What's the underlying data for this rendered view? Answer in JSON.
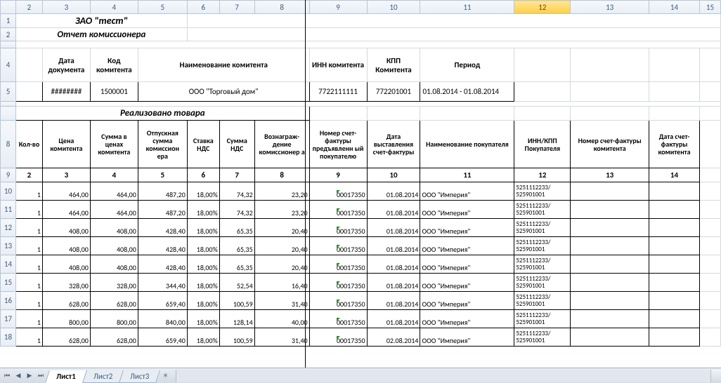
{
  "columns": [
    "",
    "2",
    "3",
    "4",
    "5",
    "6",
    "7",
    "8",
    "9",
    "10",
    "11",
    "12",
    "13",
    "14",
    "15"
  ],
  "selected_col": "12",
  "row_numbers": [
    "1",
    "2",
    "",
    "4",
    "5",
    "",
    "",
    "8",
    "9",
    "10",
    "11",
    "12",
    "13",
    "14",
    "15",
    "16",
    "17",
    "18"
  ],
  "title1": "ЗАО \"тест\"",
  "title2": "Отчет комиссионера",
  "head4": {
    "c1": "Дата документа",
    "c2": "Код комитента",
    "c3": "Наименование комитента",
    "c4": "ИНН комитента",
    "c5": "КПП Комитента",
    "c6": "Период"
  },
  "row5": {
    "c1": "########",
    "c2": "1500001",
    "c3": "ООО \"Торговый дом\"",
    "c4": "7722111111",
    "c5": "772201001",
    "c6": "01.08.2014 - 01.08.2014"
  },
  "section_title": "Реализовано товара",
  "tblhead": [
    "Кол-во",
    "Цена комитента",
    "Сумма в ценах комитента",
    "Отпускная сумма комиссион ера",
    "Ставка НДС",
    "Сумма НДС",
    "Вознаграж- дение комиссионер а",
    "Номер счет-фактуры предъявленн ый покупателю",
    "Дата выставления счет-фактуры",
    "Наименование покупателя",
    "ИНН/КПП Покупателя",
    "Номер счет-фактуры комитента",
    "Дата счет-фактуры комитента"
  ],
  "tblnums": [
    "2",
    "3",
    "4",
    "5",
    "6",
    "7",
    "8",
    "9",
    "10",
    "11",
    "12",
    "13",
    "14"
  ],
  "rows": [
    {
      "q": "1",
      "p": "464,00",
      "s": "464,00",
      "os": "487,20",
      "st": "18,00%",
      "nds": "74,32",
      "v": "23,20",
      "nf": "00017350",
      "d": "01.08.2014",
      "buyer": "ООО \"Империя\"",
      "ik": "5251112233/ 525901001"
    },
    {
      "q": "1",
      "p": "464,00",
      "s": "464,00",
      "os": "487,20",
      "st": "18,00%",
      "nds": "74,32",
      "v": "23,20",
      "nf": "00017350",
      "d": "01.08.2014",
      "buyer": "ООО \"Империя\"",
      "ik": "5251112233/ 525901001"
    },
    {
      "q": "1",
      "p": "408,00",
      "s": "408,00",
      "os": "428,40",
      "st": "18,00%",
      "nds": "65,35",
      "v": "20,40",
      "nf": "00017350",
      "d": "01.08.2014",
      "buyer": "ООО \"Империя\"",
      "ik": "5251112233/ 525901001"
    },
    {
      "q": "1",
      "p": "408,00",
      "s": "408,00",
      "os": "428,40",
      "st": "18,00%",
      "nds": "65,35",
      "v": "20,40",
      "nf": "00017350",
      "d": "01.08.2014",
      "buyer": "ООО \"Империя\"",
      "ik": "5251112233/ 525901001"
    },
    {
      "q": "1",
      "p": "408,00",
      "s": "408,00",
      "os": "428,40",
      "st": "18,00%",
      "nds": "65,35",
      "v": "20,40",
      "nf": "00017350",
      "d": "01.08.2014",
      "buyer": "ООО \"Империя\"",
      "ik": "5251112233/ 525901001"
    },
    {
      "q": "1",
      "p": "328,00",
      "s": "328,00",
      "os": "344,40",
      "st": "18,00%",
      "nds": "52,54",
      "v": "16,40",
      "nf": "00017350",
      "d": "01.08.2014",
      "buyer": "ООО \"Империя\"",
      "ik": "5251112233/ 525901001"
    },
    {
      "q": "1",
      "p": "628,00",
      "s": "628,00",
      "os": "659,40",
      "st": "18,00%",
      "nds": "100,59",
      "v": "31,40",
      "nf": "00017350",
      "d": "01.08.2014",
      "buyer": "ООО \"Империя\"",
      "ik": "5251112233/ 525901001"
    },
    {
      "q": "1",
      "p": "800,00",
      "s": "800,00",
      "os": "840,00",
      "st": "18,00%",
      "nds": "128,14",
      "v": "40,00",
      "nf": "00017350",
      "d": "01.08.2014",
      "buyer": "ООО \"Империя\"",
      "ik": "5251112233/ 525901001"
    },
    {
      "q": "1",
      "p": "628,00",
      "s": "628,00",
      "os": "659,40",
      "st": "18,00%",
      "nds": "100,59",
      "v": "31,40",
      "nf": "00017350",
      "d": "02.08.2014",
      "buyer": "ООО \"Империя\"",
      "ik": "5251112233/ 525901001"
    }
  ],
  "tabs": {
    "t1": "Лист1",
    "t2": "Лист2",
    "t3": "Лист3"
  }
}
